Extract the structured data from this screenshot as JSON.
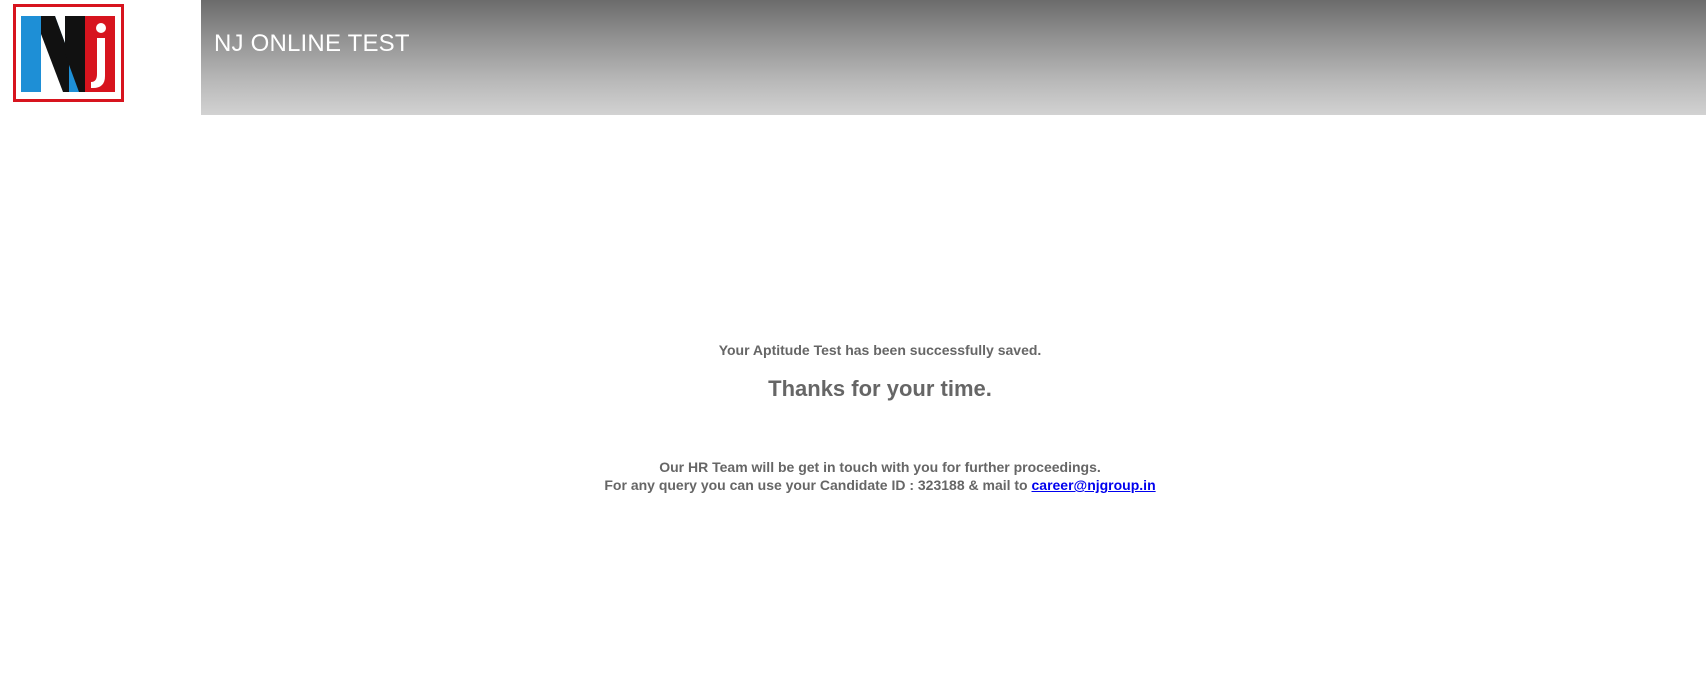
{
  "header": {
    "title": "NJ ONLINE TEST",
    "logo_text_n": "N",
    "logo_text_j": "j",
    "logo_colors": {
      "border": "#d7141e",
      "blue": "#1e8fd6",
      "black": "#111111",
      "red": "#d7141e"
    }
  },
  "main": {
    "saved_message": "Your Aptitude Test has been successfully saved.",
    "thanks_message": "Thanks for your time.",
    "hr_message": "Our HR Team will be get in touch with you for further proceedings.",
    "query_prefix": "For any query you can use your Candidate ID : 323188 & mail to",
    "email_link": "career@njgroup.in"
  },
  "colors": {
    "text": "#666666",
    "link": "#0000ee",
    "header_gradient_top": "#6b6b6b",
    "header_gradient_bottom": "#d2d2d2"
  }
}
